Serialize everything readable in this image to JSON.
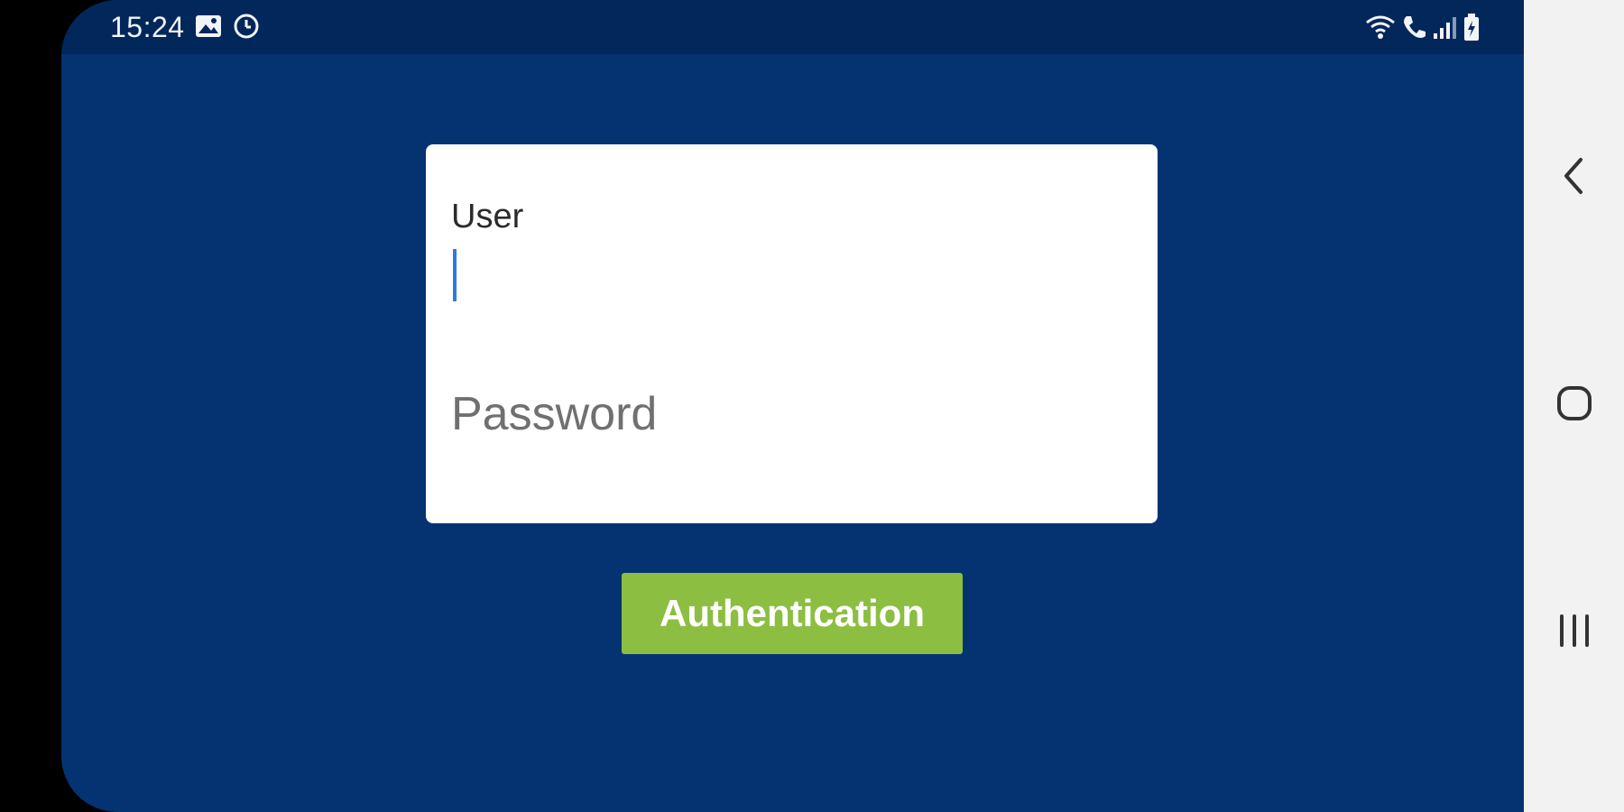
{
  "status_bar": {
    "time": "15:24",
    "left_icons": [
      "image-icon",
      "alarm-icon"
    ],
    "right_icons": [
      "wifi-icon",
      "wifi-call-icon",
      "signal-icon",
      "battery-icon"
    ]
  },
  "login": {
    "user_label": "User",
    "user_value": "",
    "password_placeholder": "Password",
    "password_value": ""
  },
  "actions": {
    "auth_label": "Authentication"
  },
  "nav_bar": {
    "icons": [
      "back-icon",
      "home-icon",
      "recents-icon"
    ]
  },
  "colors": {
    "background": "#053372",
    "status_bar": "#02275a",
    "button": "#8cbe42",
    "caret": "#2e7ae0",
    "nav_bar": "#f2f2f2"
  }
}
